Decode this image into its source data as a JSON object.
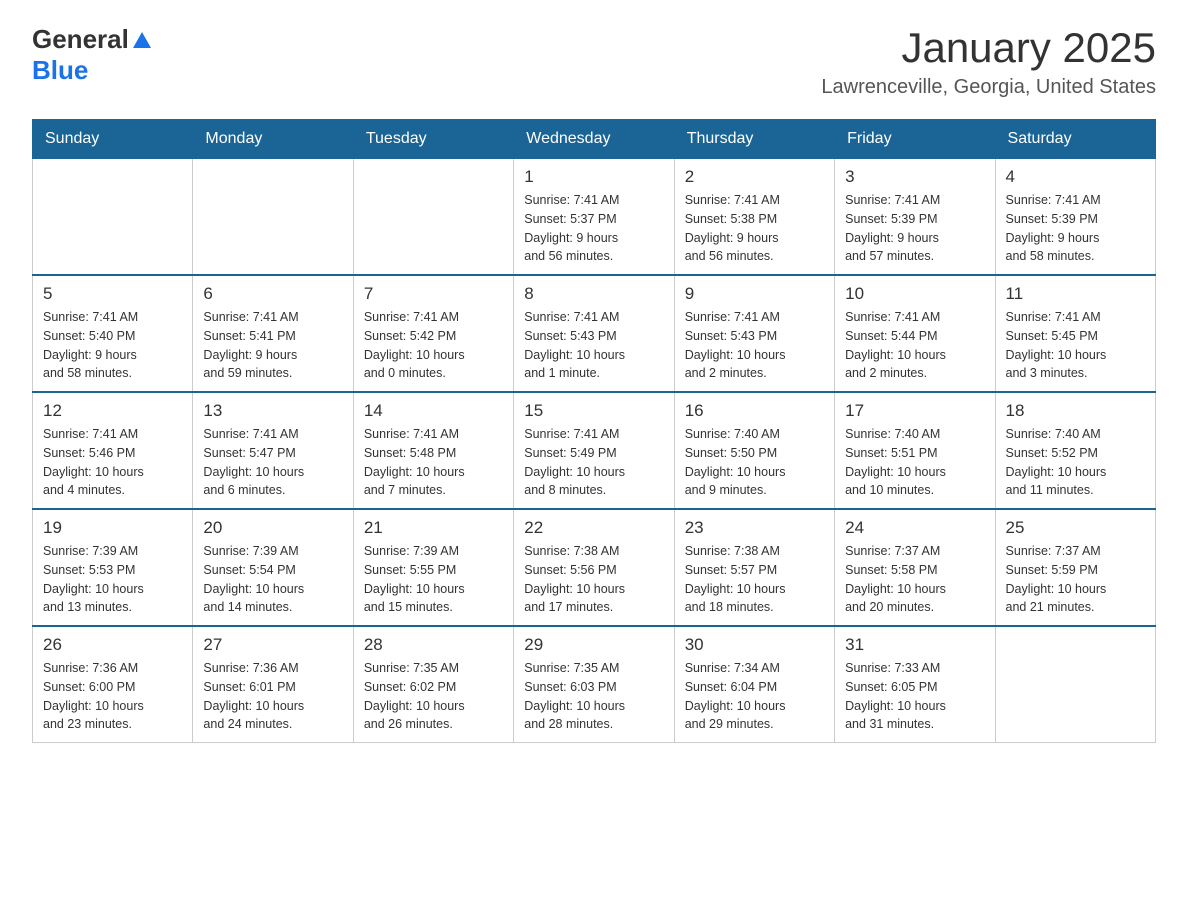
{
  "header": {
    "logo_general": "General",
    "logo_blue": "Blue",
    "month_title": "January 2025",
    "location": "Lawrenceville, Georgia, United States"
  },
  "days_of_week": [
    "Sunday",
    "Monday",
    "Tuesday",
    "Wednesday",
    "Thursday",
    "Friday",
    "Saturday"
  ],
  "weeks": [
    {
      "days": [
        {
          "num": "",
          "info": ""
        },
        {
          "num": "",
          "info": ""
        },
        {
          "num": "",
          "info": ""
        },
        {
          "num": "1",
          "info": "Sunrise: 7:41 AM\nSunset: 5:37 PM\nDaylight: 9 hours\nand 56 minutes."
        },
        {
          "num": "2",
          "info": "Sunrise: 7:41 AM\nSunset: 5:38 PM\nDaylight: 9 hours\nand 56 minutes."
        },
        {
          "num": "3",
          "info": "Sunrise: 7:41 AM\nSunset: 5:39 PM\nDaylight: 9 hours\nand 57 minutes."
        },
        {
          "num": "4",
          "info": "Sunrise: 7:41 AM\nSunset: 5:39 PM\nDaylight: 9 hours\nand 58 minutes."
        }
      ]
    },
    {
      "days": [
        {
          "num": "5",
          "info": "Sunrise: 7:41 AM\nSunset: 5:40 PM\nDaylight: 9 hours\nand 58 minutes."
        },
        {
          "num": "6",
          "info": "Sunrise: 7:41 AM\nSunset: 5:41 PM\nDaylight: 9 hours\nand 59 minutes."
        },
        {
          "num": "7",
          "info": "Sunrise: 7:41 AM\nSunset: 5:42 PM\nDaylight: 10 hours\nand 0 minutes."
        },
        {
          "num": "8",
          "info": "Sunrise: 7:41 AM\nSunset: 5:43 PM\nDaylight: 10 hours\nand 1 minute."
        },
        {
          "num": "9",
          "info": "Sunrise: 7:41 AM\nSunset: 5:43 PM\nDaylight: 10 hours\nand 2 minutes."
        },
        {
          "num": "10",
          "info": "Sunrise: 7:41 AM\nSunset: 5:44 PM\nDaylight: 10 hours\nand 2 minutes."
        },
        {
          "num": "11",
          "info": "Sunrise: 7:41 AM\nSunset: 5:45 PM\nDaylight: 10 hours\nand 3 minutes."
        }
      ]
    },
    {
      "days": [
        {
          "num": "12",
          "info": "Sunrise: 7:41 AM\nSunset: 5:46 PM\nDaylight: 10 hours\nand 4 minutes."
        },
        {
          "num": "13",
          "info": "Sunrise: 7:41 AM\nSunset: 5:47 PM\nDaylight: 10 hours\nand 6 minutes."
        },
        {
          "num": "14",
          "info": "Sunrise: 7:41 AM\nSunset: 5:48 PM\nDaylight: 10 hours\nand 7 minutes."
        },
        {
          "num": "15",
          "info": "Sunrise: 7:41 AM\nSunset: 5:49 PM\nDaylight: 10 hours\nand 8 minutes."
        },
        {
          "num": "16",
          "info": "Sunrise: 7:40 AM\nSunset: 5:50 PM\nDaylight: 10 hours\nand 9 minutes."
        },
        {
          "num": "17",
          "info": "Sunrise: 7:40 AM\nSunset: 5:51 PM\nDaylight: 10 hours\nand 10 minutes."
        },
        {
          "num": "18",
          "info": "Sunrise: 7:40 AM\nSunset: 5:52 PM\nDaylight: 10 hours\nand 11 minutes."
        }
      ]
    },
    {
      "days": [
        {
          "num": "19",
          "info": "Sunrise: 7:39 AM\nSunset: 5:53 PM\nDaylight: 10 hours\nand 13 minutes."
        },
        {
          "num": "20",
          "info": "Sunrise: 7:39 AM\nSunset: 5:54 PM\nDaylight: 10 hours\nand 14 minutes."
        },
        {
          "num": "21",
          "info": "Sunrise: 7:39 AM\nSunset: 5:55 PM\nDaylight: 10 hours\nand 15 minutes."
        },
        {
          "num": "22",
          "info": "Sunrise: 7:38 AM\nSunset: 5:56 PM\nDaylight: 10 hours\nand 17 minutes."
        },
        {
          "num": "23",
          "info": "Sunrise: 7:38 AM\nSunset: 5:57 PM\nDaylight: 10 hours\nand 18 minutes."
        },
        {
          "num": "24",
          "info": "Sunrise: 7:37 AM\nSunset: 5:58 PM\nDaylight: 10 hours\nand 20 minutes."
        },
        {
          "num": "25",
          "info": "Sunrise: 7:37 AM\nSunset: 5:59 PM\nDaylight: 10 hours\nand 21 minutes."
        }
      ]
    },
    {
      "days": [
        {
          "num": "26",
          "info": "Sunrise: 7:36 AM\nSunset: 6:00 PM\nDaylight: 10 hours\nand 23 minutes."
        },
        {
          "num": "27",
          "info": "Sunrise: 7:36 AM\nSunset: 6:01 PM\nDaylight: 10 hours\nand 24 minutes."
        },
        {
          "num": "28",
          "info": "Sunrise: 7:35 AM\nSunset: 6:02 PM\nDaylight: 10 hours\nand 26 minutes."
        },
        {
          "num": "29",
          "info": "Sunrise: 7:35 AM\nSunset: 6:03 PM\nDaylight: 10 hours\nand 28 minutes."
        },
        {
          "num": "30",
          "info": "Sunrise: 7:34 AM\nSunset: 6:04 PM\nDaylight: 10 hours\nand 29 minutes."
        },
        {
          "num": "31",
          "info": "Sunrise: 7:33 AM\nSunset: 6:05 PM\nDaylight: 10 hours\nand 31 minutes."
        },
        {
          "num": "",
          "info": ""
        }
      ]
    }
  ]
}
